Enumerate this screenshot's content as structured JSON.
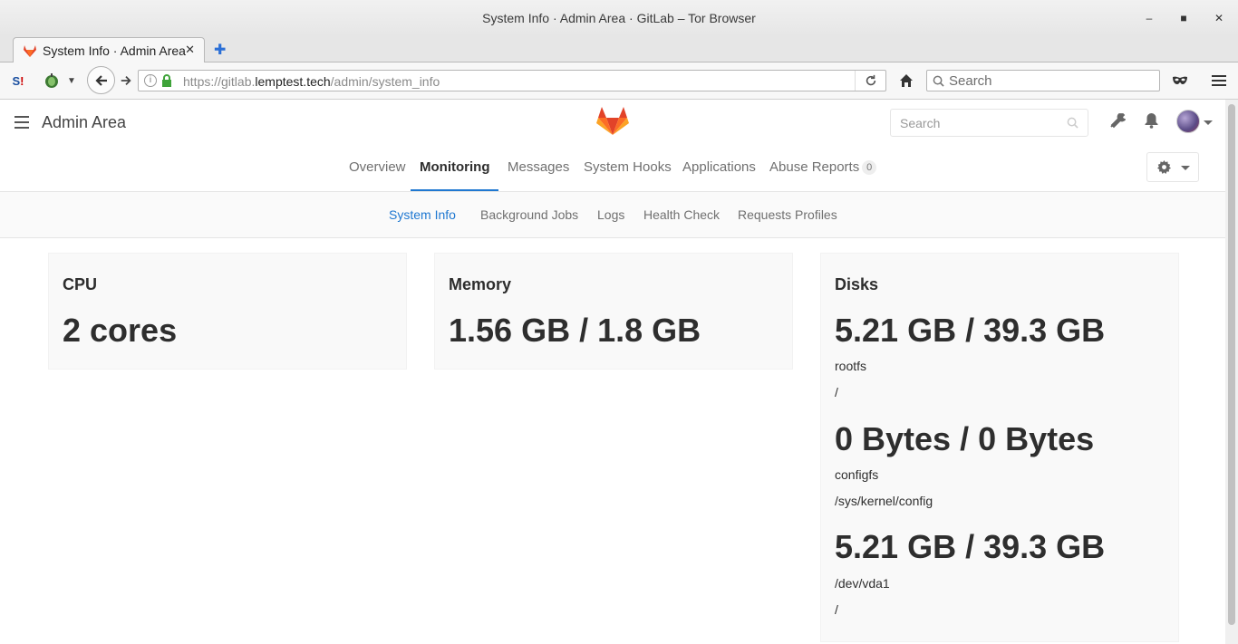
{
  "browser": {
    "window_title": "System Info · Admin Area · GitLab – Tor Browser",
    "tab_title": "System Info · Admin Area · GitLab",
    "url_scheme": "https://gitlab.",
    "url_host": "lemptest.tech",
    "url_path": "/admin/system_info",
    "search_placeholder": "Search"
  },
  "header": {
    "area_title": "Admin Area",
    "search_placeholder": "Search"
  },
  "tabs": {
    "items": [
      {
        "label": "Overview"
      },
      {
        "label": "Monitoring"
      },
      {
        "label": "Messages"
      },
      {
        "label": "System Hooks"
      },
      {
        "label": "Applications"
      },
      {
        "label": "Abuse Reports"
      }
    ],
    "abuse_count": "0",
    "active": "Monitoring"
  },
  "subtabs": {
    "items": [
      {
        "label": "System Info"
      },
      {
        "label": "Background Jobs"
      },
      {
        "label": "Logs"
      },
      {
        "label": "Health Check"
      },
      {
        "label": "Requests Profiles"
      }
    ],
    "active": "System Info"
  },
  "cpu": {
    "title": "CPU",
    "value": "2 cores"
  },
  "memory": {
    "title": "Memory",
    "value": "1.56 GB / 1.8 GB"
  },
  "disks": {
    "title": "Disks",
    "items": [
      {
        "usage": "5.21 GB / 39.3 GB",
        "device": "rootfs",
        "mount": "/"
      },
      {
        "usage": "0 Bytes / 0 Bytes",
        "device": "configfs",
        "mount": "/sys/kernel/config"
      },
      {
        "usage": "5.21 GB / 39.3 GB",
        "device": "/dev/vda1",
        "mount": "/"
      }
    ]
  },
  "colors": {
    "accent": "#1f78d1",
    "gitlab_orange": "#fc6d26"
  }
}
